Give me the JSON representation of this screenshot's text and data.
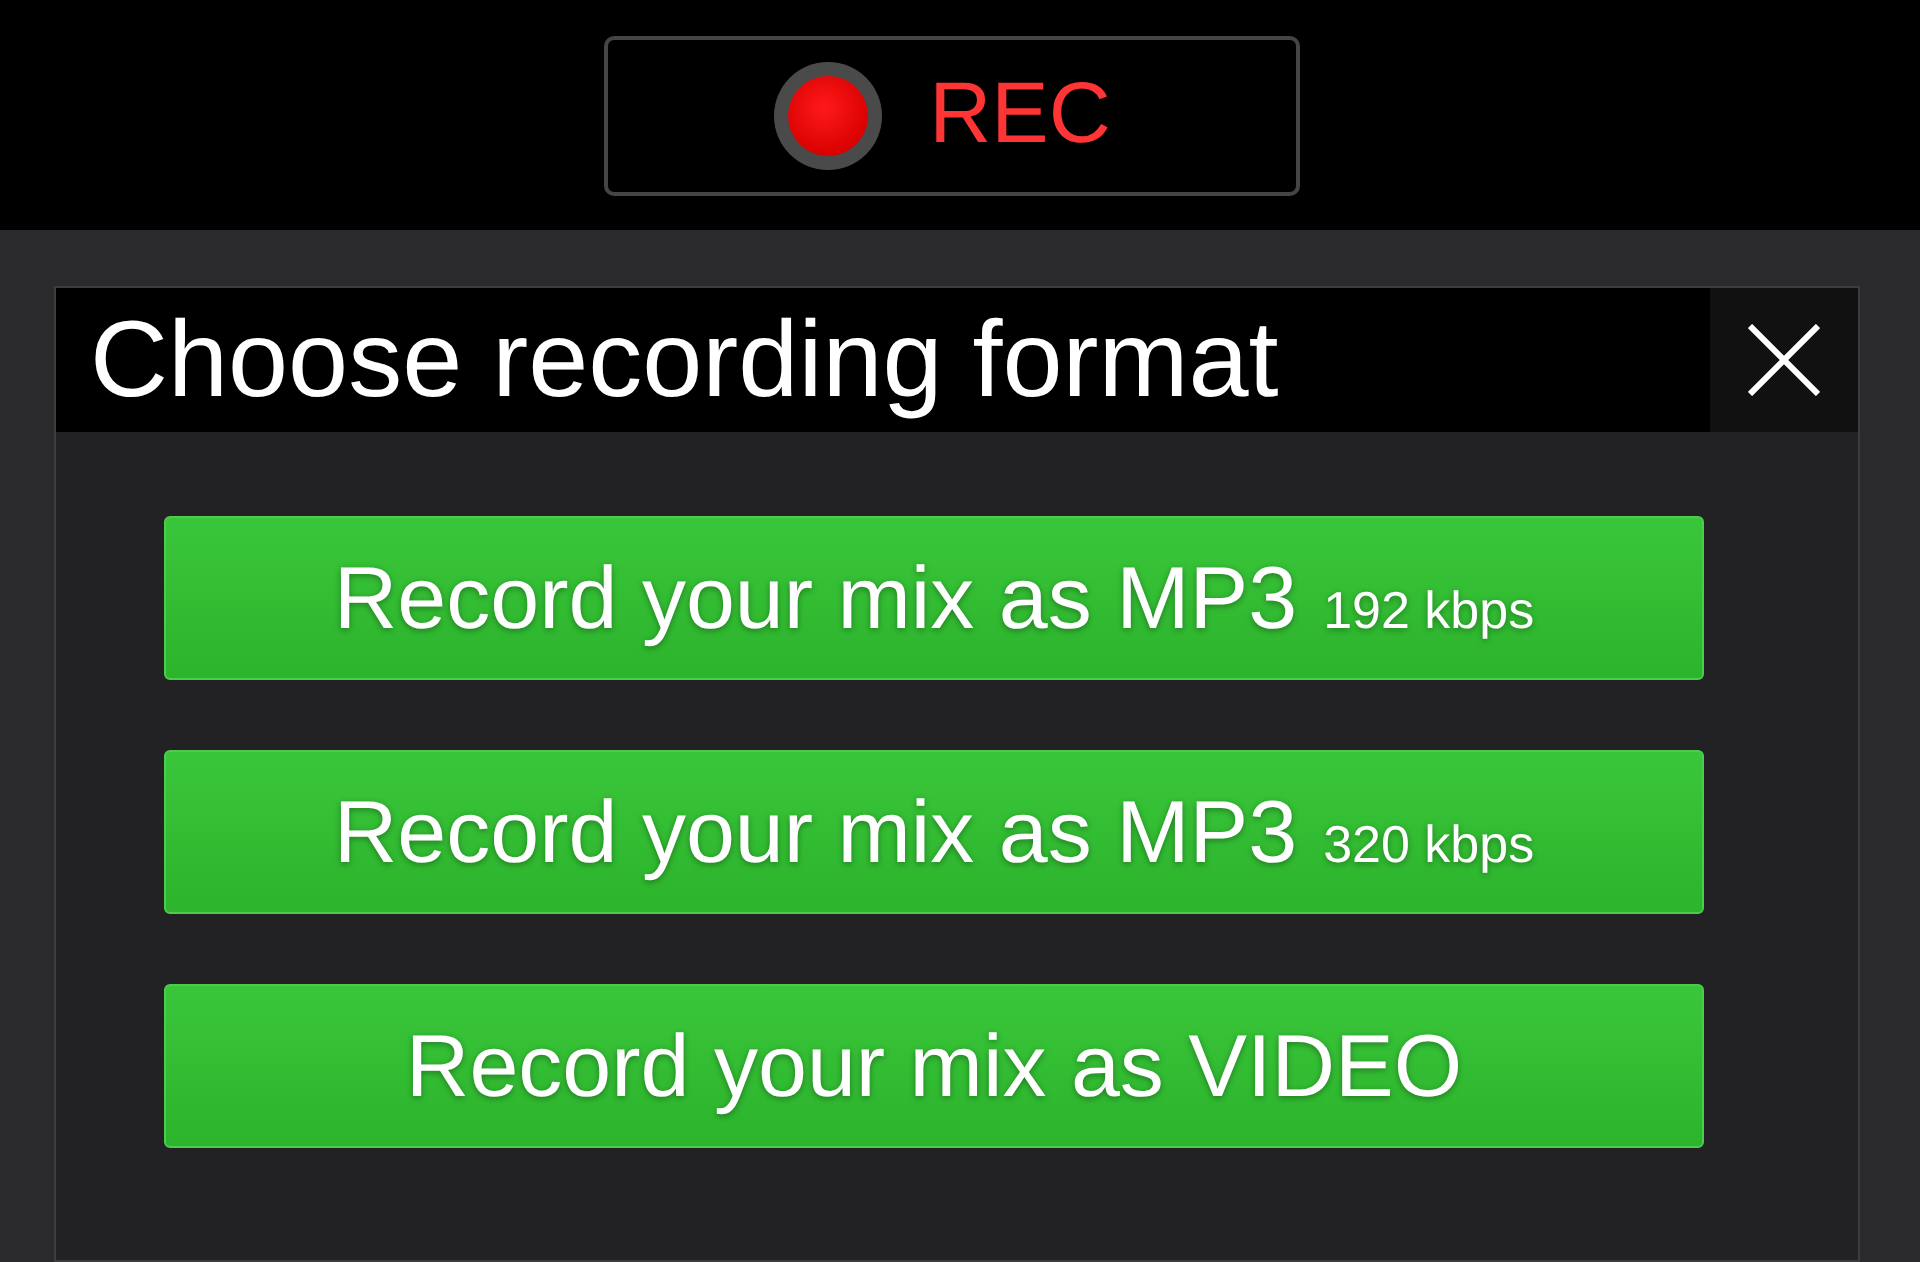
{
  "rec_button": {
    "label": "REC"
  },
  "dialog": {
    "title": "Choose recording format",
    "options": [
      {
        "label": "Record your mix as MP3",
        "detail": "192 kbps"
      },
      {
        "label": "Record your mix as MP3",
        "detail": "320 kbps"
      },
      {
        "label": "Record your mix as VIDEO"
      }
    ]
  }
}
